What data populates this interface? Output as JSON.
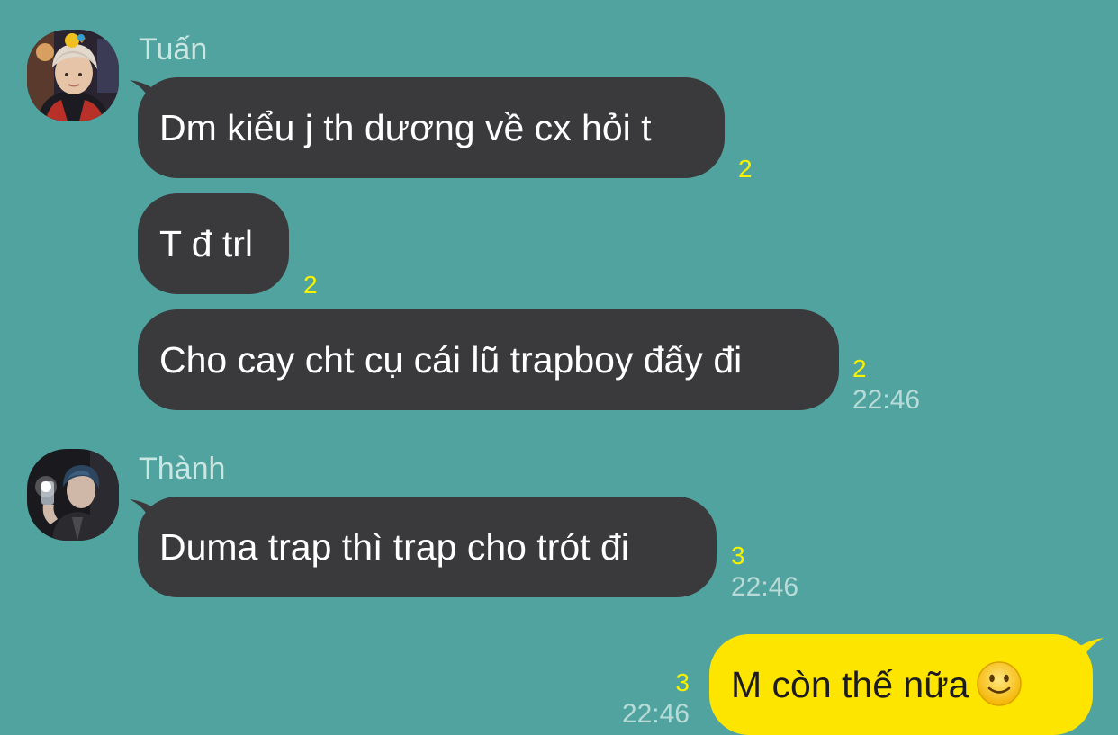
{
  "colors": {
    "background": "#51a39f",
    "incoming_bubble": "#3a3a3c",
    "outgoing_bubble": "#fee500",
    "sender_name": "#c9e6e2",
    "unread_count": "#f7f200",
    "timestamp": "#b8dbd7"
  },
  "groups": [
    {
      "sender": "Tuấn",
      "avatar_icon": "profile-photo-avatar",
      "messages": [
        {
          "text": "Dm kiểu j th dương về cx hỏi t",
          "unread": "2",
          "time": ""
        },
        {
          "text": "T đ trl",
          "unread": "2",
          "time": ""
        },
        {
          "text": "Cho cay cht cụ cái lũ trapboy đấy đi",
          "unread": "2",
          "time": "22:46"
        }
      ]
    },
    {
      "sender": "Thành",
      "avatar_icon": "mirror-selfie-avatar",
      "messages": [
        {
          "text": "Duma trap thì trap cho trót đi",
          "unread": "3",
          "time": "22:46"
        }
      ]
    }
  ],
  "outgoing": {
    "text": "M còn thế nữa",
    "emoji_icon": "slightly-smiling-face-icon",
    "unread": "3",
    "time": "22:46"
  }
}
